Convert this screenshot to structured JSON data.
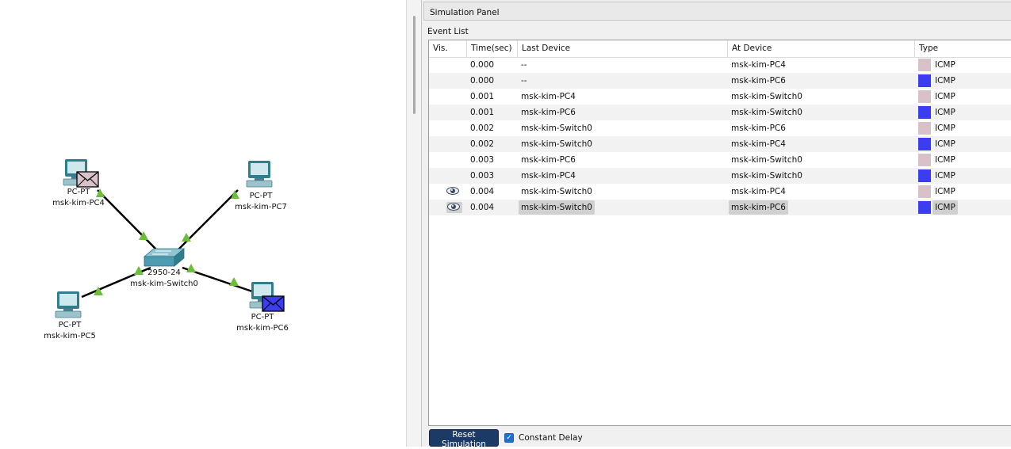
{
  "workspace": {
    "devices": [
      {
        "id": "pc4",
        "model": "PC-PT",
        "name": "msk-kim-PC4",
        "envelope": true
      },
      {
        "id": "pc7",
        "model": "PC-PT",
        "name": "msk-kim-PC7",
        "envelope": false
      },
      {
        "id": "switch0",
        "model": "2950-24",
        "name": "msk-kim-Switch0"
      },
      {
        "id": "pc5",
        "model": "PC-PT",
        "name": "msk-kim-PC5",
        "envelope": false
      },
      {
        "id": "pc6",
        "model": "PC-PT",
        "name": "msk-kim-PC6",
        "envelope": true
      }
    ]
  },
  "simulation_panel": {
    "title": "Simulation Panel",
    "event_list_label": "Event List",
    "columns": {
      "vis": "Vis.",
      "time": "Time(sec)",
      "last_device": "Last Device",
      "at_device": "At Device",
      "type": "Type"
    },
    "events": [
      {
        "vis": false,
        "time": "0.000",
        "last_device": "--",
        "at_device": "msk-kim-PC4",
        "type": "ICMP",
        "color": "#d8c1c8"
      },
      {
        "vis": false,
        "time": "0.000",
        "last_device": "--",
        "at_device": "msk-kim-PC6",
        "type": "ICMP",
        "color": "#3c3cf0"
      },
      {
        "vis": false,
        "time": "0.001",
        "last_device": "msk-kim-PC4",
        "at_device": "msk-kim-Switch0",
        "type": "ICMP",
        "color": "#d8c1c8"
      },
      {
        "vis": false,
        "time": "0.001",
        "last_device": "msk-kim-PC6",
        "at_device": "msk-kim-Switch0",
        "type": "ICMP",
        "color": "#3c3cf0"
      },
      {
        "vis": false,
        "time": "0.002",
        "last_device": "msk-kim-Switch0",
        "at_device": "msk-kim-PC6",
        "type": "ICMP",
        "color": "#d8c1c8"
      },
      {
        "vis": false,
        "time": "0.002",
        "last_device": "msk-kim-Switch0",
        "at_device": "msk-kim-PC4",
        "type": "ICMP",
        "color": "#3c3cf0"
      },
      {
        "vis": false,
        "time": "0.003",
        "last_device": "msk-kim-PC6",
        "at_device": "msk-kim-Switch0",
        "type": "ICMP",
        "color": "#d8c1c8"
      },
      {
        "vis": false,
        "time": "0.003",
        "last_device": "msk-kim-PC4",
        "at_device": "msk-kim-Switch0",
        "type": "ICMP",
        "color": "#3c3cf0"
      },
      {
        "vis": true,
        "time": "0.004",
        "last_device": "msk-kim-Switch0",
        "at_device": "msk-kim-PC4",
        "type": "ICMP",
        "color": "#d8c1c8",
        "selected": false
      },
      {
        "vis": true,
        "time": "0.004",
        "last_device": "msk-kim-Switch0",
        "at_device": "msk-kim-PC6",
        "type": "ICMP",
        "color": "#3c3cf0",
        "selected": true
      }
    ],
    "reset_button_label": "Reset Simulation",
    "constant_delay": {
      "label": "Constant Delay",
      "checked": true
    }
  },
  "colors": {
    "accent_button": "#1b3a66",
    "link_ok": "#6bbd3a",
    "icmp_pc4": "#d8c1c8",
    "icmp_pc6": "#3c3cf0"
  }
}
